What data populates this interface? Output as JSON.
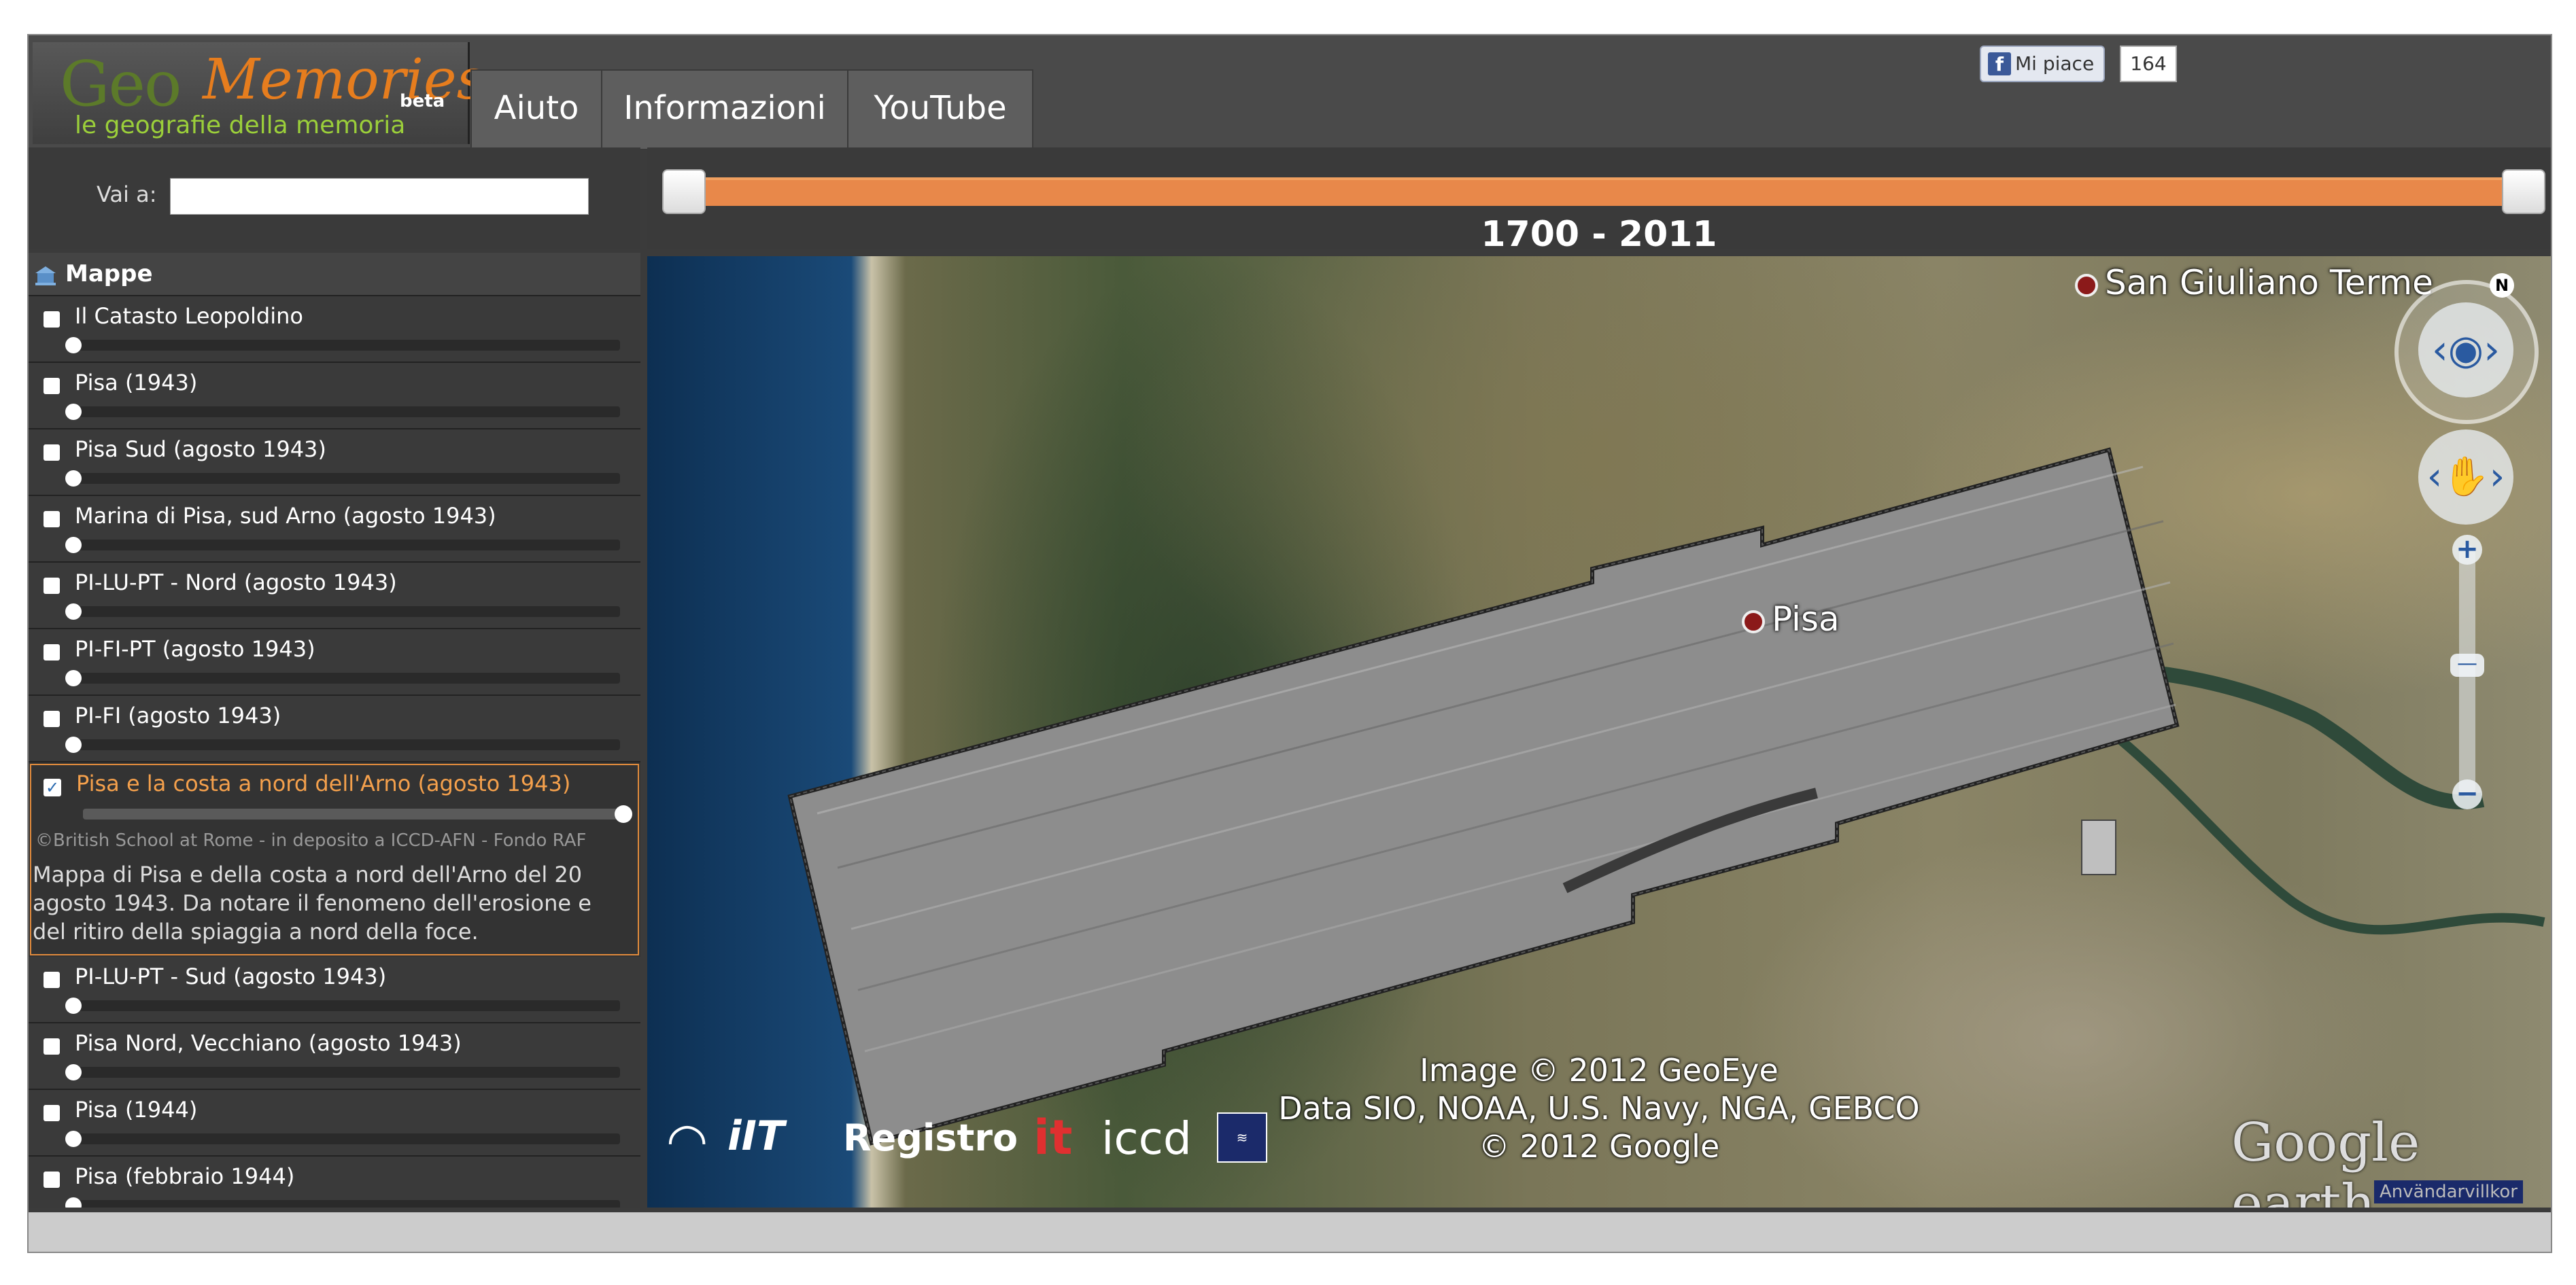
{
  "header": {
    "logo": {
      "geo": "Geo",
      "memories": "Memories",
      "beta": "beta",
      "tagline": "le geografie della memoria"
    },
    "nav": [
      "Aiuto",
      "Informazioni",
      "YouTube"
    ],
    "facebook": {
      "like_label": "Mi piace",
      "count": "164"
    }
  },
  "goto": {
    "label": "Vai a:",
    "value": ""
  },
  "timeline": {
    "start": 1700,
    "end": 2011,
    "range_label": "1700 - 2011"
  },
  "sidebar": {
    "title": "Mappe",
    "layers": [
      {
        "label": "Il Catasto Leopoldino",
        "checked": false,
        "opacity": 0
      },
      {
        "label": "Pisa (1943)",
        "checked": false,
        "opacity": 0
      },
      {
        "label": "Pisa Sud (agosto 1943)",
        "checked": false,
        "opacity": 0
      },
      {
        "label": "Marina di Pisa, sud Arno (agosto 1943)",
        "checked": false,
        "opacity": 0
      },
      {
        "label": "PI-LU-PT - Nord (agosto 1943)",
        "checked": false,
        "opacity": 0
      },
      {
        "label": "PI-FI-PT (agosto 1943)",
        "checked": false,
        "opacity": 0
      },
      {
        "label": "PI-FI (agosto 1943)",
        "checked": false,
        "opacity": 0
      }
    ],
    "active": {
      "label": "Pisa e la costa a nord dell'Arno (agosto 1943)",
      "checked": true,
      "opacity": 1,
      "credit": "©British School at Rome - in deposito a ICCD-AFN - Fondo RAF",
      "description": "Mappa di Pisa e della costa a nord dell'Arno del 20 agosto 1943. Da notare il fenomeno dell'erosione e del ritiro della spiaggia a nord della foce."
    },
    "layers_after": [
      {
        "label": "PI-LU-PT - Sud (agosto 1943)",
        "checked": false,
        "opacity": 0
      },
      {
        "label": "Pisa Nord, Vecchiano (agosto 1943)",
        "checked": false,
        "opacity": 0
      },
      {
        "label": "Pisa (1944)",
        "checked": false,
        "opacity": 0
      },
      {
        "label": "Pisa (febbraio 1944)",
        "checked": false,
        "opacity": 0
      }
    ]
  },
  "map": {
    "places": {
      "san_giuliano": "San Giuliano Terme",
      "pisa": "Pisa"
    },
    "attribution": [
      "Image © 2012 GeoEye",
      "Data SIO, NOAA, U.S. Navy, NGA, GEBCO",
      "© 2012 Google"
    ],
    "partner_logos": {
      "iit": "iIT",
      "registro": "Registro",
      "it": "it",
      "iccd": "iccd"
    },
    "google_earth": "Google earth",
    "terms": "Användarvillkor",
    "compass_n": "N"
  },
  "colors": {
    "accent": "#e8884a",
    "active_border": "#e08a3c",
    "place_dot": "#8b1a1a"
  }
}
